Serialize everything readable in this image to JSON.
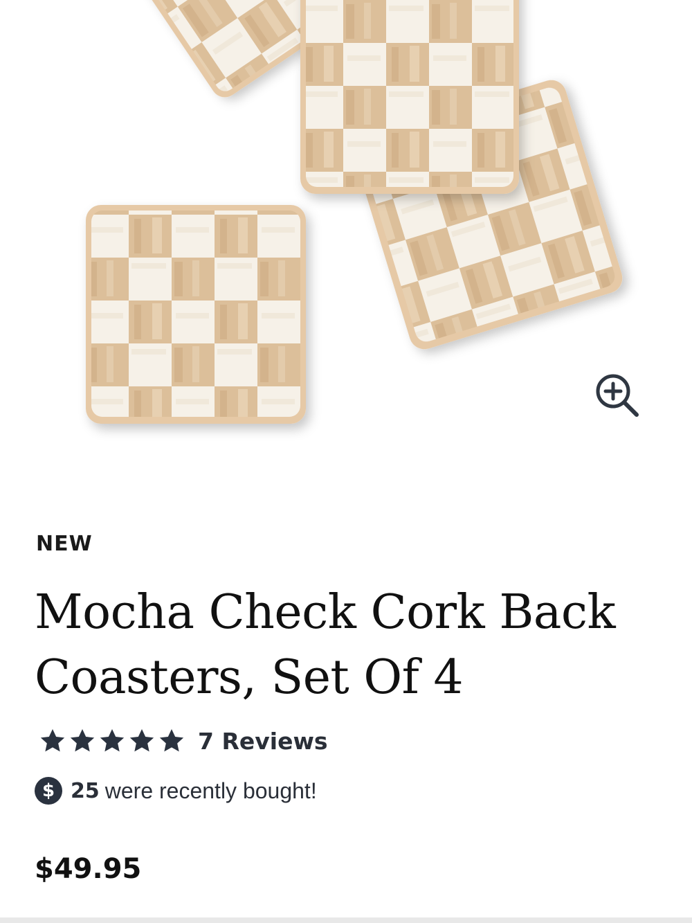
{
  "product": {
    "badge": "NEW",
    "title": "Mocha Check Cork Back Coasters, Set Of 4",
    "rating": 5,
    "rating_max": 5,
    "reviews_label": "7 Reviews",
    "bought_count": "25",
    "bought_text": "were recently bought!",
    "price": "$49.95"
  },
  "image": {
    "alt": "Mocha Check Cork Back Coasters",
    "zoom_icon": "zoom-in-icon"
  },
  "icons": {
    "star": "star-icon",
    "dollar_symbol": "$"
  },
  "colors": {
    "text": "#111111",
    "secondary_text": "#2a2f38",
    "star": "#2a323f",
    "tan": "#dcbf9a",
    "cream": "#f7f3ec",
    "cork_edge": "#e6c9a6"
  }
}
